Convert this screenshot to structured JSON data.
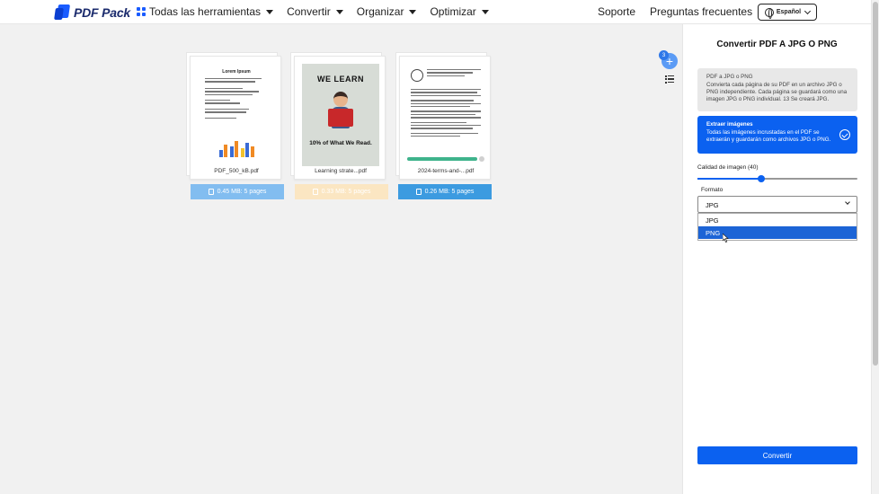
{
  "header": {
    "logo_text": "PDF Pack",
    "nav": [
      {
        "label": "Todas las herramientas"
      },
      {
        "label": "Convertir"
      },
      {
        "label": "Organizar"
      },
      {
        "label": "Optimizar"
      }
    ],
    "support": "Soporte",
    "faq": "Preguntas frecuentes",
    "language": "Español"
  },
  "files": [
    {
      "name": "PDF_500_kB.pdf",
      "meta": "0.45 MB: 5 pages",
      "meta_color": "#82bdf0",
      "thumb_title": "Lorem Ipsum"
    },
    {
      "name": "Learning strate...pdf",
      "meta": "0.33 MB: 5 pages",
      "meta_color": "#fbe6c2",
      "poster_title": "WE LEARN",
      "poster_sub": "10% of What We Read."
    },
    {
      "name": "2024-terms-and-...pdf",
      "meta": "0.26 MB: 5 pages",
      "meta_color": "#3c9be0"
    }
  ],
  "badge_count": "3",
  "panel": {
    "title": "Convertir PDF A JPG O PNG",
    "option1_title": "PDF a JPG o PNG",
    "option1_desc": "Convierta cada página de su PDF en un archivo JPG o PNG independiente. Cada página se guardará como una imagen JPG o PNG individual. 13 Se creará JPG.",
    "option2_title": "Extraer imágenes",
    "option2_desc": "Todas las imágenes incrustadas en el PDF se extraerán y guardarán como archivos JPG o PNG.",
    "quality_label": "Calidad de imagen (40)",
    "quality_value": 40,
    "format_label": "Formato",
    "format_selected": "JPG",
    "format_options": [
      "JPG",
      "PNG"
    ],
    "convert_label": "Convertir"
  },
  "colors": {
    "accent": "#0b61f0"
  }
}
